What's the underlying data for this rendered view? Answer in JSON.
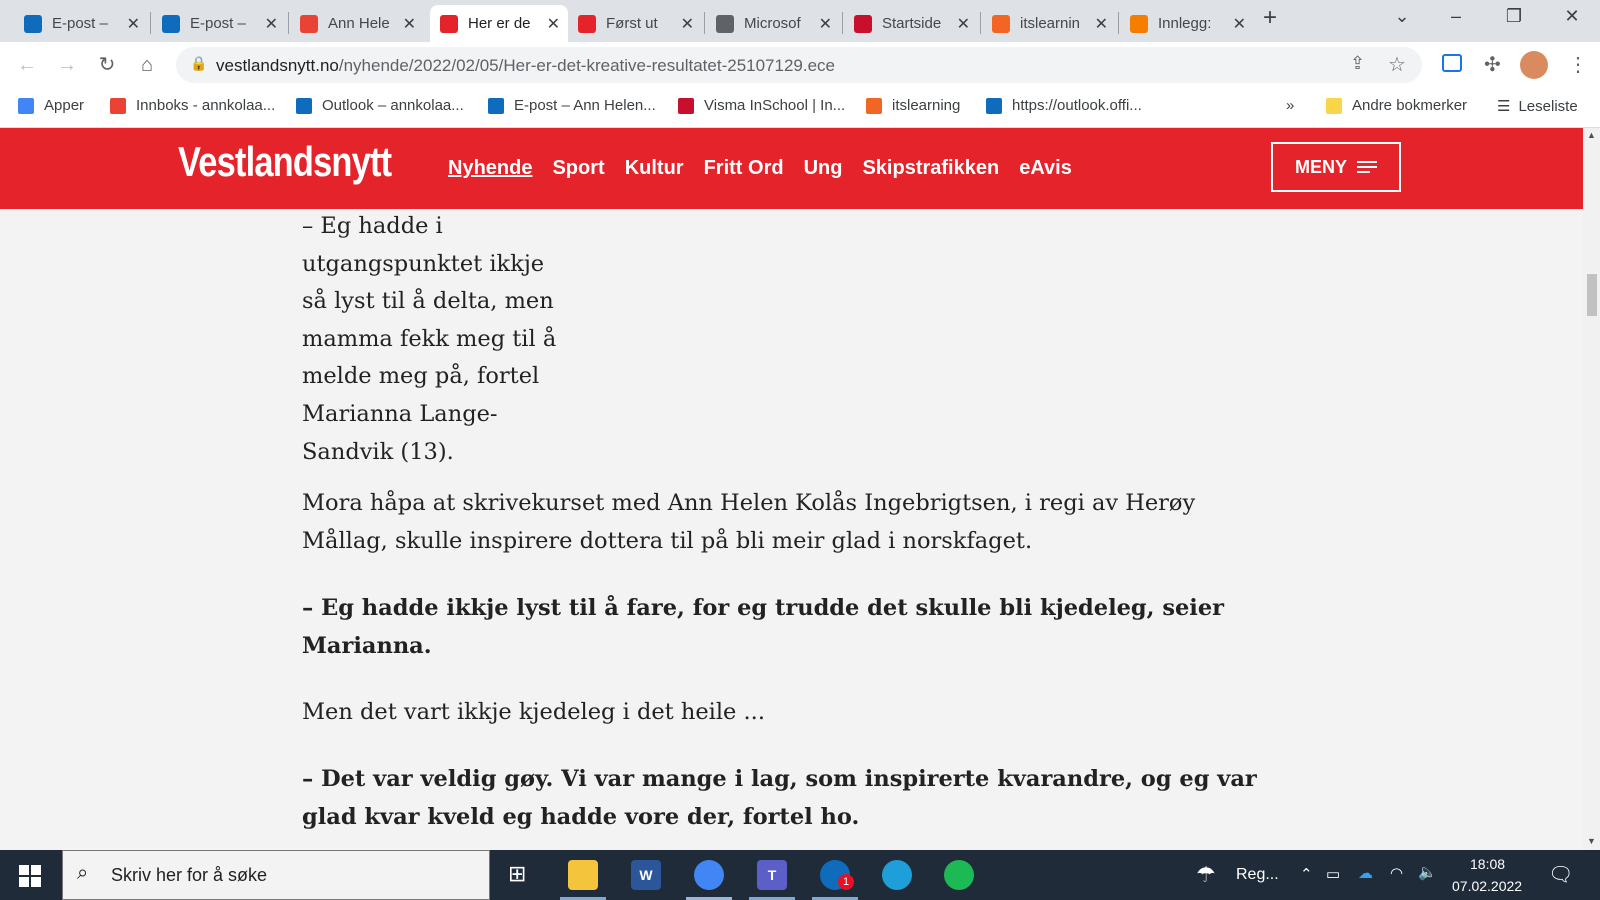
{
  "tabs": [
    {
      "label": "E-post –",
      "icon": "outlook-icon",
      "color": "#0f6cbd"
    },
    {
      "label": "E-post –",
      "icon": "outlook-icon",
      "color": "#0f6cbd"
    },
    {
      "label": "Ann Hele",
      "icon": "gmail-icon",
      "color": "#ea4335"
    },
    {
      "label": "Her er de",
      "icon": "vestlandsnytt-icon",
      "color": "#e4232b",
      "active": true
    },
    {
      "label": "Først ut",
      "icon": "vestlandsnytt-icon",
      "color": "#e4232b"
    },
    {
      "label": "Microsof",
      "icon": "globe-icon",
      "color": "#5f6368"
    },
    {
      "label": "Startside",
      "icon": "visma-icon",
      "color": "#c8102e"
    },
    {
      "label": "itslearnin",
      "icon": "itslearning-icon",
      "color": "#f26522"
    },
    {
      "label": "Innlegg:",
      "icon": "blogger-icon",
      "color": "#f57d00"
    }
  ],
  "address": {
    "domain": "vestlandsnytt.no",
    "path": "/nyhende/2022/02/05/Her-er-det-kreative-resultatet-25107129.ece"
  },
  "bookmarks": [
    {
      "label": "Apper",
      "icon": "apps-grid-icon",
      "color": "#4285f4"
    },
    {
      "label": "Innboks - annkolaa...",
      "icon": "gmail-icon",
      "color": "#ea4335"
    },
    {
      "label": "Outlook – annkolaa...",
      "icon": "outlook-icon",
      "color": "#0f6cbd"
    },
    {
      "label": "E-post – Ann Helen...",
      "icon": "outlook-icon",
      "color": "#0f6cbd"
    },
    {
      "label": "Visma InSchool | In...",
      "icon": "visma-icon",
      "color": "#c8102e"
    },
    {
      "label": "itslearning",
      "icon": "itslearning-icon",
      "color": "#f26522"
    },
    {
      "label": "https://outlook.offi...",
      "icon": "outlook-icon",
      "color": "#0f6cbd"
    }
  ],
  "bookmarks_overflow": "»",
  "other_bookmarks": "Andre bokmerker",
  "reading_list": "Leseliste",
  "site": {
    "logo": "Vestlandsnytt",
    "nav": [
      "Nyhende",
      "Sport",
      "Kultur",
      "Fritt Ord",
      "Ung",
      "Skipstrafikken",
      "eAvis"
    ],
    "menu": "MENY",
    "brand_color": "#e4232b"
  },
  "article": {
    "quote_intro": "– Eg hadde i utgangspunktet ikkje så lyst til å delta, men mamma fekk meg til å melde meg på, fortel Marianna Lange-Sandvik (13).",
    "p2": "Mora håpa at skrivekurset med Ann Helen Kolås Ingebrigtsen, i regi av Herøy Mållag, skulle inspirere dottera til på bli meir glad i norskfaget.",
    "p3": "– Eg hadde ikkje lyst til å fare, for eg trudde det skulle bli kjedeleg, seier Marianna.",
    "p4": "Men det vart ikkje kjedeleg i det heile ...",
    "p5": "– Det var veldig gøy. Vi var mange i lag, som inspirerte kvarandre, og eg var glad kvar kveld eg hadde vore der, fortel ho."
  },
  "taskbar": {
    "search_placeholder": "Skriv her for å søke",
    "weather": "Reg...",
    "time": "18:08",
    "date": "07.02.2022",
    "badge": "1"
  }
}
